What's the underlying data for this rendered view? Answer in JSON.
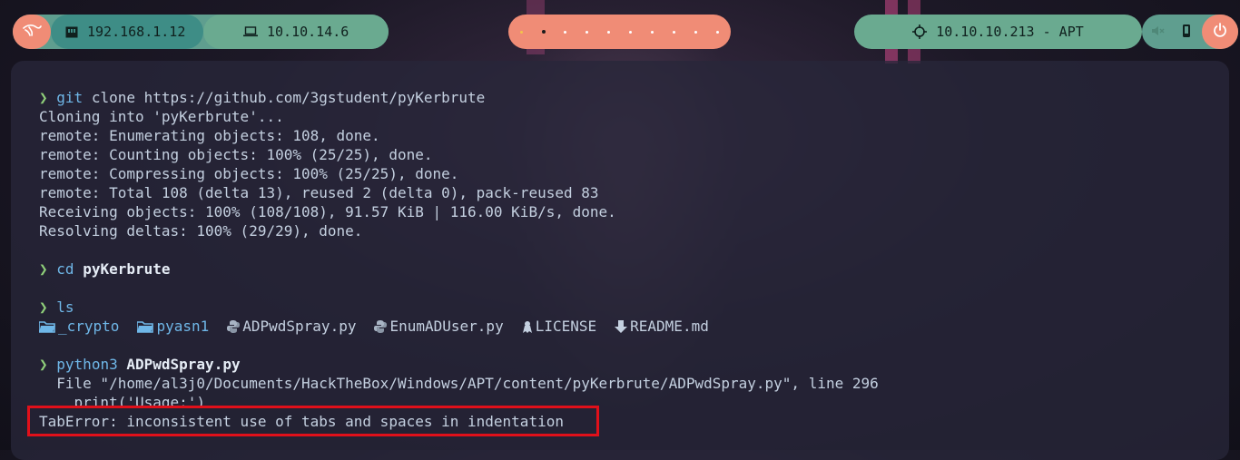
{
  "topbar": {
    "local_ip": "192.168.1.12",
    "vpn_ip": "10.10.14.6",
    "target": "10.10.10.213 - APT",
    "workspace_count": 10,
    "active_workspace": 2
  },
  "terminal": {
    "prompt_symbol": "❯",
    "git": {
      "cmd": "git",
      "rest": " clone https://github.com/3gstudent/pyKerbrute"
    },
    "git_output": [
      "Cloning into 'pyKerbrute'...",
      "remote: Enumerating objects: 108, done.",
      "remote: Counting objects: 100% (25/25), done.",
      "remote: Compressing objects: 100% (25/25), done.",
      "remote: Total 108 (delta 13), reused 2 (delta 0), pack-reused 83",
      "Receiving objects: 100% (108/108), 91.57 KiB | 116.00 KiB/s, done.",
      "Resolving deltas: 100% (29/29), done."
    ],
    "cd": {
      "cmd": "cd",
      "arg": "pyKerbrute"
    },
    "ls": {
      "cmd": "ls"
    },
    "ls_items": [
      {
        "name": "_crypto",
        "kind": "dir"
      },
      {
        "name": "pyasn1",
        "kind": "dir"
      },
      {
        "name": "ADPwdSpray.py",
        "kind": "python"
      },
      {
        "name": "EnumADUser.py",
        "kind": "python"
      },
      {
        "name": "LICENSE",
        "kind": "license"
      },
      {
        "name": "README.md",
        "kind": "markdown"
      }
    ],
    "python": {
      "cmd": "python3",
      "arg": "ADPwdSpray.py"
    },
    "traceback": [
      "  File \"/home/al3j0/Documents/HackTheBox/Windows/APT/content/pyKerbrute/ADPwdSpray.py\", line 296",
      "    print('Usage:')"
    ],
    "error": "TabError: inconsistent use of tabs and spaces in indentation"
  },
  "colors": {
    "prompt": "#8fcf7a",
    "command": "#6fb7e8",
    "highlight_box": "#e0101a"
  }
}
